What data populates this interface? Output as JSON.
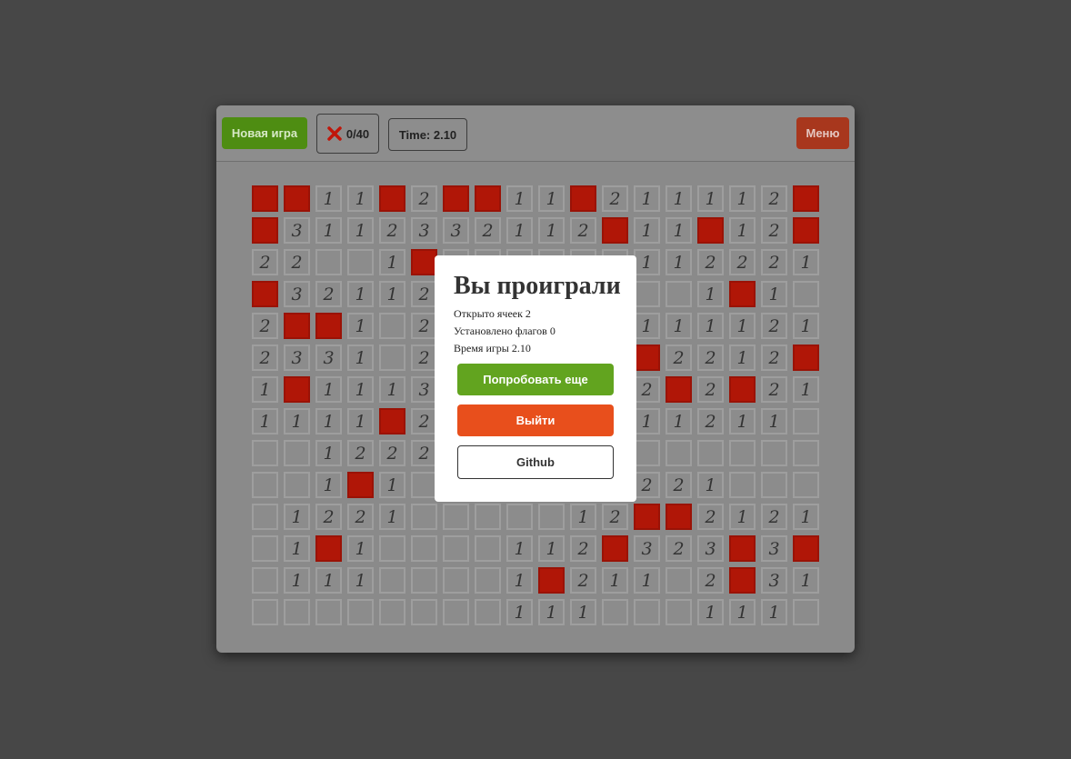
{
  "toolbar": {
    "new_game_label": "Новая игра",
    "flags_counter": "0/40",
    "time_label": "Time: 2.10",
    "menu_label": "Меню"
  },
  "board": {
    "rows": [
      [
        "*",
        "*",
        "1",
        "1",
        "*",
        "2",
        "*",
        "*",
        "1",
        "1",
        "*",
        "2",
        "1",
        "1",
        "1",
        "1",
        "2",
        "*"
      ],
      [
        "*",
        "3",
        "1",
        "1",
        "2",
        "3",
        "3",
        "2",
        "1",
        "1",
        "2",
        "*",
        "1",
        "1",
        "*",
        "1",
        "2",
        "*"
      ],
      [
        "2",
        "2",
        "",
        "",
        "1",
        "*",
        "",
        "",
        "",
        "",
        "",
        "",
        "1",
        "1",
        "2",
        "2",
        "2",
        "1"
      ],
      [
        "*",
        "3",
        "2",
        "1",
        "1",
        "2",
        "",
        "",
        "",
        "",
        "",
        "",
        "",
        "",
        "1",
        "*",
        "1",
        ""
      ],
      [
        "2",
        "*",
        "*",
        "1",
        "",
        "2",
        "",
        "",
        "",
        "",
        "",
        "",
        "1",
        "1",
        "1",
        "1",
        "2",
        "1"
      ],
      [
        "2",
        "3",
        "3",
        "1",
        "",
        "2",
        "",
        "",
        "",
        "",
        "",
        "",
        "*",
        "2",
        "2",
        "1",
        "2",
        "*"
      ],
      [
        "1",
        "*",
        "1",
        "1",
        "1",
        "3",
        "",
        "",
        "",
        "",
        "",
        "",
        "2",
        "*",
        "2",
        "*",
        "2",
        "1"
      ],
      [
        "1",
        "1",
        "1",
        "1",
        "*",
        "2",
        "",
        "",
        "",
        "",
        "",
        "",
        "1",
        "1",
        "2",
        "1",
        "1",
        ""
      ],
      [
        "",
        "",
        "1",
        "2",
        "2",
        "2",
        "",
        "",
        "",
        "",
        "",
        "",
        "",
        "",
        "",
        "",
        "",
        ""
      ],
      [
        "",
        "",
        "1",
        "*",
        "1",
        "",
        "",
        "",
        "",
        "",
        "",
        "",
        "2",
        "2",
        "1",
        "",
        "",
        ""
      ],
      [
        "",
        "1",
        "2",
        "2",
        "1",
        "",
        "",
        "",
        "",
        "",
        "1",
        "2",
        "*",
        "*",
        "2",
        "1",
        "2",
        "1"
      ],
      [
        "",
        "1",
        "*",
        "1",
        "",
        "",
        "",
        "",
        "1",
        "1",
        "2",
        "*",
        "3",
        "2",
        "3",
        "*",
        "3",
        "*"
      ],
      [
        "",
        "1",
        "1",
        "1",
        "",
        "",
        "",
        "",
        "1",
        "*",
        "2",
        "1",
        "1",
        "",
        "2",
        "*",
        "3",
        "1"
      ],
      [
        "",
        "",
        "",
        "",
        "",
        "",
        "",
        "",
        "1",
        "1",
        "1",
        "",
        "",
        "",
        "1",
        "1",
        "1",
        ""
      ]
    ]
  },
  "modal": {
    "title": "Вы проиграли",
    "opened_cells": "Открыто ячеек 2",
    "flags_set": "Установлено флагов 0",
    "game_time": "Время игры 2.10",
    "retry_label": "Попробовать еще",
    "exit_label": "Выйти",
    "github_label": "Github"
  },
  "colors": {
    "background": "#474747",
    "new_game": "#4e8d12",
    "menu": "#a8371d",
    "mine": "#b01607",
    "retry": "#62a41f",
    "exit": "#e84f1c"
  },
  "icons": {
    "flag_counter_icon": "x-icon"
  }
}
